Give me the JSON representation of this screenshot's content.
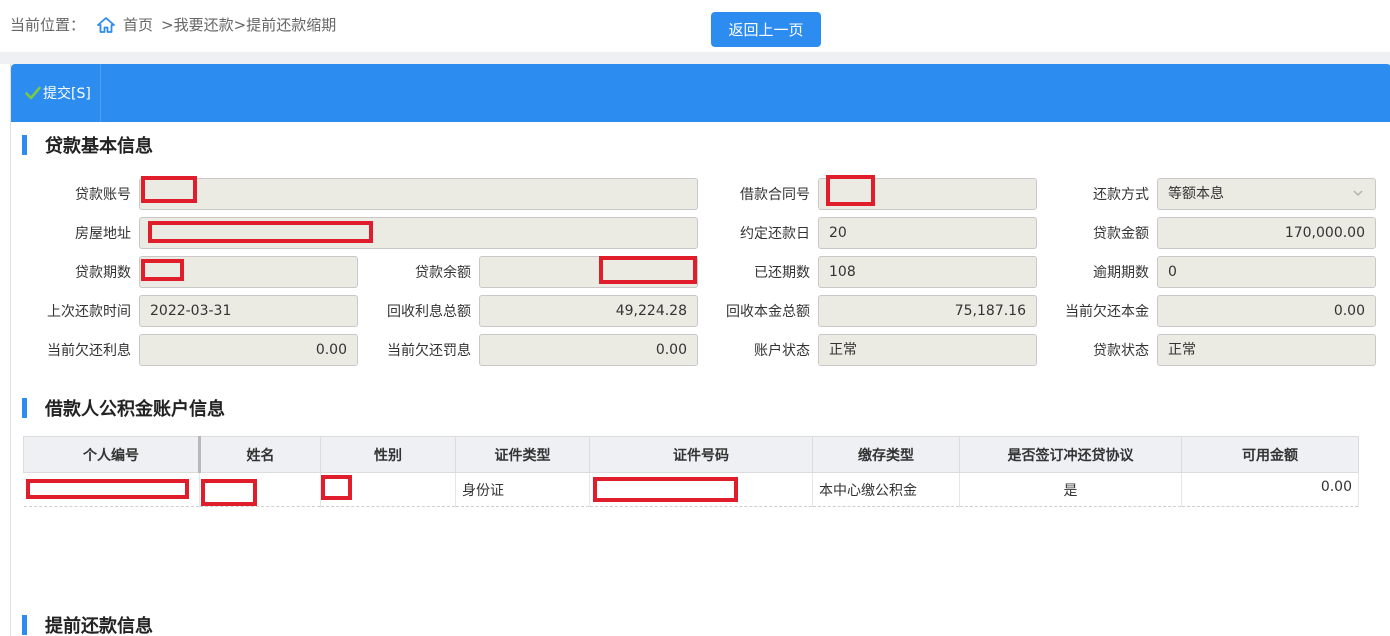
{
  "breadcrumb": {
    "prefix": "当前位置：",
    "home": "首页",
    "sep1": ">",
    "level1": "我要还款",
    "sep2": ">",
    "level2": "提前还款缩期"
  },
  "back_button": "返回上一页",
  "toolbar": {
    "submit_label": "提交[S]"
  },
  "sections": {
    "loan_info": "贷款基本信息",
    "account_info": "借款人公积金账户信息",
    "prepay_info": "提前还款信息"
  },
  "loan": {
    "account_no": {
      "label": "贷款账号",
      "value": ""
    },
    "contract_no": {
      "label": "借款合同号",
      "value": ""
    },
    "repay_method": {
      "label": "还款方式",
      "value": "等额本息"
    },
    "address": {
      "label": "房屋地址",
      "value": ""
    },
    "repay_day": {
      "label": "约定还款日",
      "value": "20"
    },
    "loan_amount": {
      "label": "贷款金额",
      "value": "170,000.00"
    },
    "term": {
      "label": "贷款期数",
      "value": ""
    },
    "balance": {
      "label": "贷款余额",
      "value": ""
    },
    "paid_terms": {
      "label": "已还期数",
      "value": "108"
    },
    "overdue_terms": {
      "label": "逾期期数",
      "value": "0"
    },
    "last_repay": {
      "label": "上次还款时间",
      "value": "2022-03-31"
    },
    "interest_total": {
      "label": "回收利息总额",
      "value": "49,224.28"
    },
    "principal_total": {
      "label": "回收本金总额",
      "value": "75,187.16"
    },
    "owed_principal": {
      "label": "当前欠还本金",
      "value": "0.00"
    },
    "owed_interest": {
      "label": "当前欠还利息",
      "value": "0.00"
    },
    "owed_penalty": {
      "label": "当前欠还罚息",
      "value": "0.00"
    },
    "account_status": {
      "label": "账户状态",
      "value": "正常"
    },
    "loan_status": {
      "label": "贷款状态",
      "value": "正常"
    }
  },
  "table": {
    "headers": [
      "个人编号",
      "姓名",
      "性别",
      "证件类型",
      "证件号码",
      "缴存类型",
      "是否签订冲还贷协议",
      "可用金额"
    ],
    "rows": [
      {
        "id": "",
        "name": "",
        "gender": "",
        "id_type": "身份证",
        "id_no": "",
        "deposit_type": "本中心缴公积金",
        "agreement": "是",
        "available": "0.00"
      }
    ]
  },
  "colors": {
    "accent": "#2d8cf0",
    "redact": "#e01e2b"
  }
}
